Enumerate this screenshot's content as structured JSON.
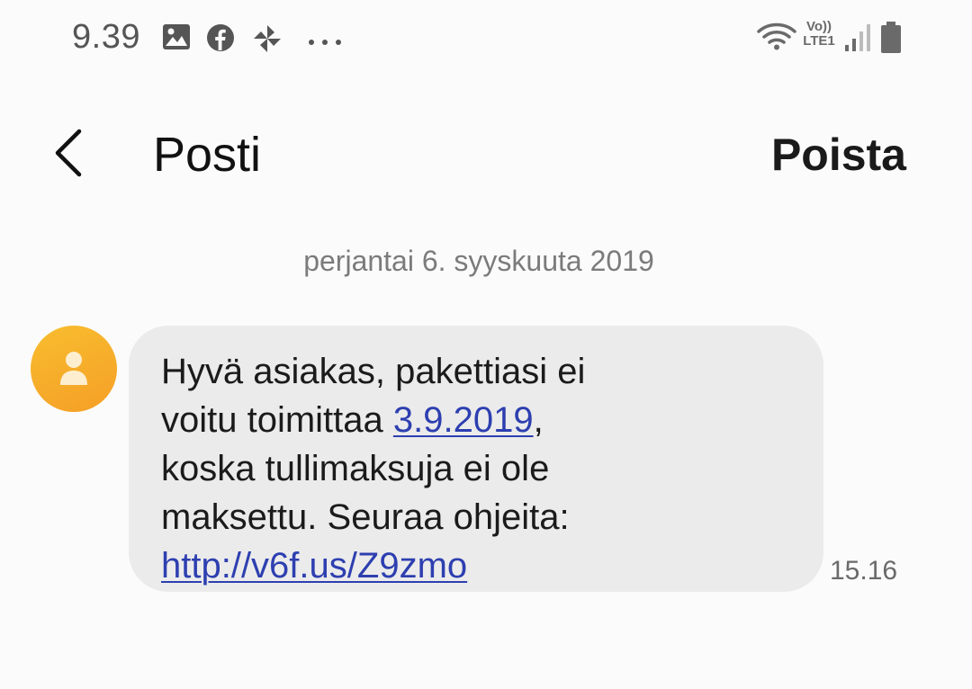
{
  "status_bar": {
    "time": "9.39",
    "icons": [
      "gallery-icon",
      "facebook-icon",
      "pinwheel-icon",
      "more-dots-icon",
      "wifi-icon",
      "volte-icon",
      "signal-icon",
      "battery-icon"
    ],
    "volte_top": "Vo))",
    "volte_bottom": "LTE1"
  },
  "header": {
    "back_icon": "chevron-left-icon",
    "title": "Posti",
    "delete_label": "Poista"
  },
  "conversation": {
    "date": "perjantai 6. syyskuuta 2019",
    "message": {
      "line1": "Hyvä asiakas, pakettiasi ei",
      "line2_before": "voitu toimittaa ",
      "line2_link": "3.9.2019",
      "line2_after": ",",
      "line3": "koska tullimaksuja ei ole",
      "line4": "maksettu. Seuraa ohjeita:",
      "line5_link": "http://v6f.us/Z9zmo",
      "time": "15.16"
    }
  },
  "colors": {
    "avatar": "#f5a827",
    "bubble": "#ebebeb",
    "link": "#2d3fb0",
    "background": "#fbfbfb"
  }
}
